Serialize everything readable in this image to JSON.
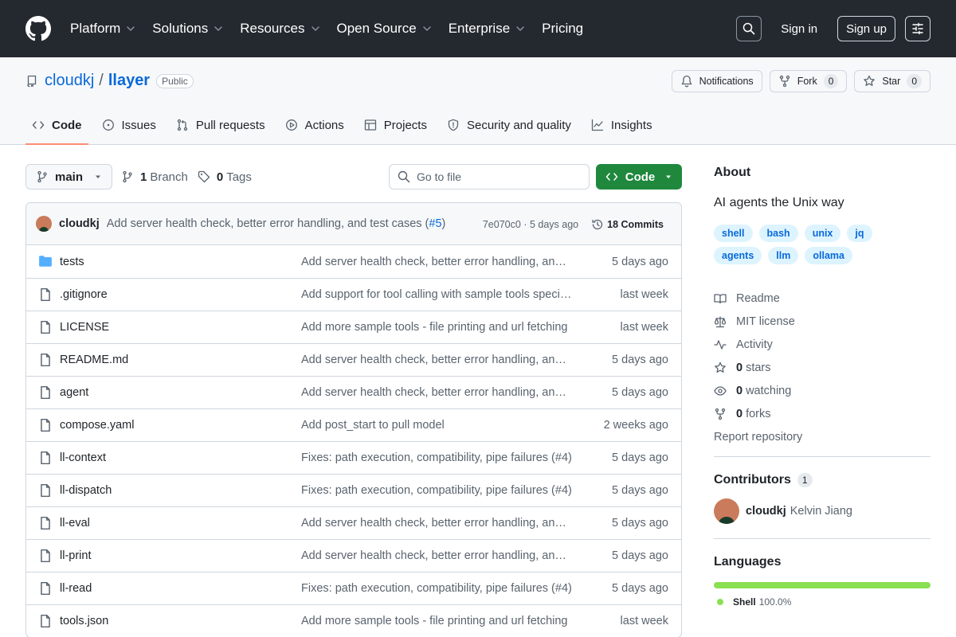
{
  "colors": {
    "header_bg": "#24292f",
    "accent": "#0969da",
    "primary_button": "#1f883d",
    "shell_lang": "#89e051",
    "tab_underline": "#fd8c73"
  },
  "topnav": [
    {
      "label": "Platform",
      "dropdown": true
    },
    {
      "label": "Solutions",
      "dropdown": true
    },
    {
      "label": "Resources",
      "dropdown": true
    },
    {
      "label": "Open Source",
      "dropdown": true
    },
    {
      "label": "Enterprise",
      "dropdown": true
    },
    {
      "label": "Pricing",
      "dropdown": false
    }
  ],
  "header": {
    "sign_in": "Sign in",
    "sign_up": "Sign up"
  },
  "repo": {
    "owner": "cloudkj",
    "separator": "/",
    "name": "llayer",
    "visibility": "Public",
    "notifications_label": "Notifications",
    "fork_label": "Fork",
    "fork_count": "0",
    "star_label": "Star",
    "star_count": "0"
  },
  "tabs": [
    {
      "label": "Code",
      "icon": "code-icon",
      "active": true
    },
    {
      "label": "Issues",
      "icon": "issue-icon"
    },
    {
      "label": "Pull requests",
      "icon": "pull-request-icon"
    },
    {
      "label": "Actions",
      "icon": "play-icon"
    },
    {
      "label": "Projects",
      "icon": "table-icon"
    },
    {
      "label": "Security and quality",
      "icon": "shield-icon"
    },
    {
      "label": "Insights",
      "icon": "graph-icon"
    }
  ],
  "toolbar": {
    "branch": "main",
    "branch_count": "1",
    "branch_label": "Branch",
    "tag_count": "0",
    "tag_label": "Tags",
    "goto_placeholder": "Go to file",
    "code_label": "Code"
  },
  "latest_commit": {
    "author": "cloudkj",
    "message": "Add server health check, better error handling, and test cases (",
    "pr": "#5",
    "message_end": ")",
    "hash": "7e070c0",
    "dot": "·",
    "age": "5 days ago",
    "commits_label": "18 Commits"
  },
  "files": [
    {
      "name": "tests",
      "type": "dir",
      "message": "Add server health check, better error handling, and test cases",
      "age": "5 days ago"
    },
    {
      "name": ".gitignore",
      "type": "file",
      "message": "Add support for tool calling with sample tools specified",
      "age": "last week"
    },
    {
      "name": "LICENSE",
      "type": "file",
      "message": "Add more sample tools - file printing and url fetching",
      "age": "last week"
    },
    {
      "name": "README.md",
      "type": "file",
      "message": "Add server health check, better error handling, and test cases",
      "age": "5 days ago"
    },
    {
      "name": "agent",
      "type": "file",
      "message": "Add server health check, better error handling, and test cases",
      "age": "5 days ago"
    },
    {
      "name": "compose.yaml",
      "type": "file",
      "message": "Add post_start to pull model",
      "age": "2 weeks ago"
    },
    {
      "name": "ll-context",
      "type": "file",
      "message": "Fixes: path execution, compatibility, pipe failures (#4)",
      "age": "5 days ago"
    },
    {
      "name": "ll-dispatch",
      "type": "file",
      "message": "Fixes: path execution, compatibility, pipe failures (#4)",
      "age": "5 days ago"
    },
    {
      "name": "ll-eval",
      "type": "file",
      "message": "Add server health check, better error handling, and test cases",
      "age": "5 days ago"
    },
    {
      "name": "ll-print",
      "type": "file",
      "message": "Add server health check, better error handling, and test cases",
      "age": "5 days ago"
    },
    {
      "name": "ll-read",
      "type": "file",
      "message": "Fixes: path execution, compatibility, pipe failures (#4)",
      "age": "5 days ago"
    },
    {
      "name": "tools.json",
      "type": "file",
      "message": "Add more sample tools - file printing and url fetching",
      "age": "last week"
    }
  ],
  "about": {
    "title": "About",
    "description": "AI agents the Unix way",
    "topics": [
      "shell",
      "bash",
      "unix",
      "jq",
      "agents",
      "llm",
      "ollama"
    ],
    "readme": "Readme",
    "license": "MIT license",
    "activity": "Activity",
    "stars_count": "0",
    "stars_label": "stars",
    "watching_count": "0",
    "watching_label": "watching",
    "forks_count": "0",
    "forks_label": "forks",
    "report": "Report repository"
  },
  "contributors": {
    "title": "Contributors",
    "count": "1",
    "login": "cloudkj",
    "name": "Kelvin Jiang"
  },
  "languages": {
    "title": "Languages",
    "items": [
      {
        "name": "Shell",
        "percent": "100.0%"
      }
    ]
  }
}
